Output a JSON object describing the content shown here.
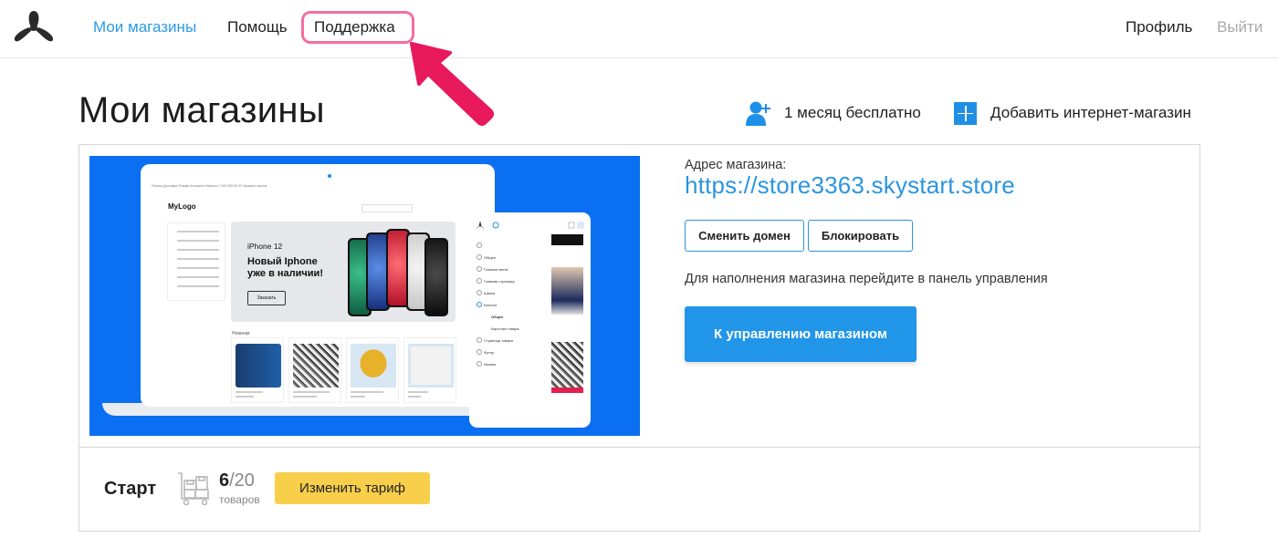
{
  "nav": {
    "stores": "Мои магазины",
    "help": "Помощь",
    "support": "Поддержка",
    "profile": "Профиль",
    "logout": "Выйти"
  },
  "header": {
    "title": "Мои магазины",
    "promo": "1 месяц бесплатно",
    "add_store": "Добавить интернет-магазин"
  },
  "store": {
    "address_label": "Адрес магазина:",
    "address_url": "https://store3363.skystart.store",
    "change_domain": "Сменить домен",
    "block": "Блокировать",
    "hint": "Для наполнения магазина перейдите в панель управления",
    "manage": "К управлению магазином",
    "preview": {
      "logo": "MyLogo",
      "topbar": "Оплата  Доставка  Отзывы  Контакты  Новости          7 000 000-00-00          Заказать звонок",
      "banner_label": "iPhone 12",
      "banner_line1": "Новый Iphone",
      "banner_line2": "уже в наличии!",
      "banner_button": "Заказать",
      "news": "Новинки",
      "mobile_menu": [
        "Общее",
        "Главное меню",
        "Главная страница",
        "Шапка",
        "Каталог",
        "Общее",
        "Карточка товара",
        "Страница товара",
        "Футер",
        "Иконки"
      ]
    }
  },
  "tariff": {
    "plan": "Старт",
    "current": "6",
    "total": "/20",
    "unit": "товаров",
    "change": "Изменить тариф"
  },
  "colors": {
    "accent": "#2196e9",
    "link": "#2b95e0",
    "highlight": "#f26ea1",
    "arrow": "#e8195c",
    "tariff_button": "#f7cf4a",
    "preview_bg": "#0a6ff0"
  }
}
